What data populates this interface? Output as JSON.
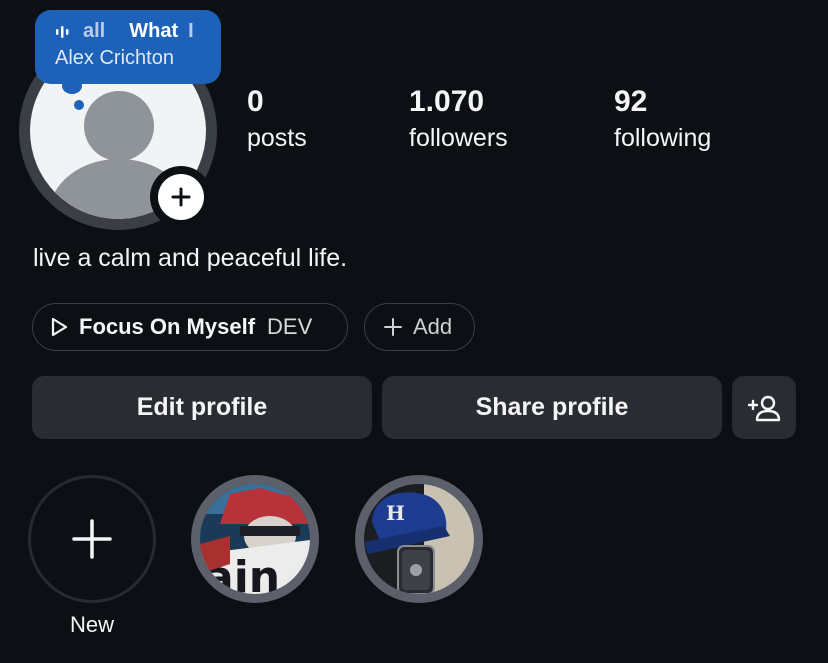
{
  "note": {
    "song_fragment_1": "all",
    "song_fragment_2": "What",
    "song_fragment_3": "I",
    "author": "Alex Crichton",
    "icon": "audio-waveform-icon"
  },
  "avatar": {
    "badge_icon": "plus-icon"
  },
  "stats": {
    "posts": {
      "count": "0",
      "label": "posts"
    },
    "followers": {
      "count": "1.070",
      "label": "followers"
    },
    "following": {
      "count": "92",
      "label": "following"
    }
  },
  "bio": "live a calm and peaceful life.",
  "music": {
    "icon": "play-icon",
    "title": "Focus On Myself",
    "artist": "DEV"
  },
  "add_link": {
    "icon": "plus-icon",
    "label": "Add"
  },
  "actions": {
    "edit_label": "Edit profile",
    "share_label": "Share profile",
    "discover_icon": "add-person-icon"
  },
  "highlights": {
    "new_label": "New",
    "new_icon": "plus-icon"
  },
  "colors": {
    "background": "#0c1014",
    "note_bubble": "#1d62b8",
    "button": "#292c32",
    "ring": "#3a3e45"
  }
}
